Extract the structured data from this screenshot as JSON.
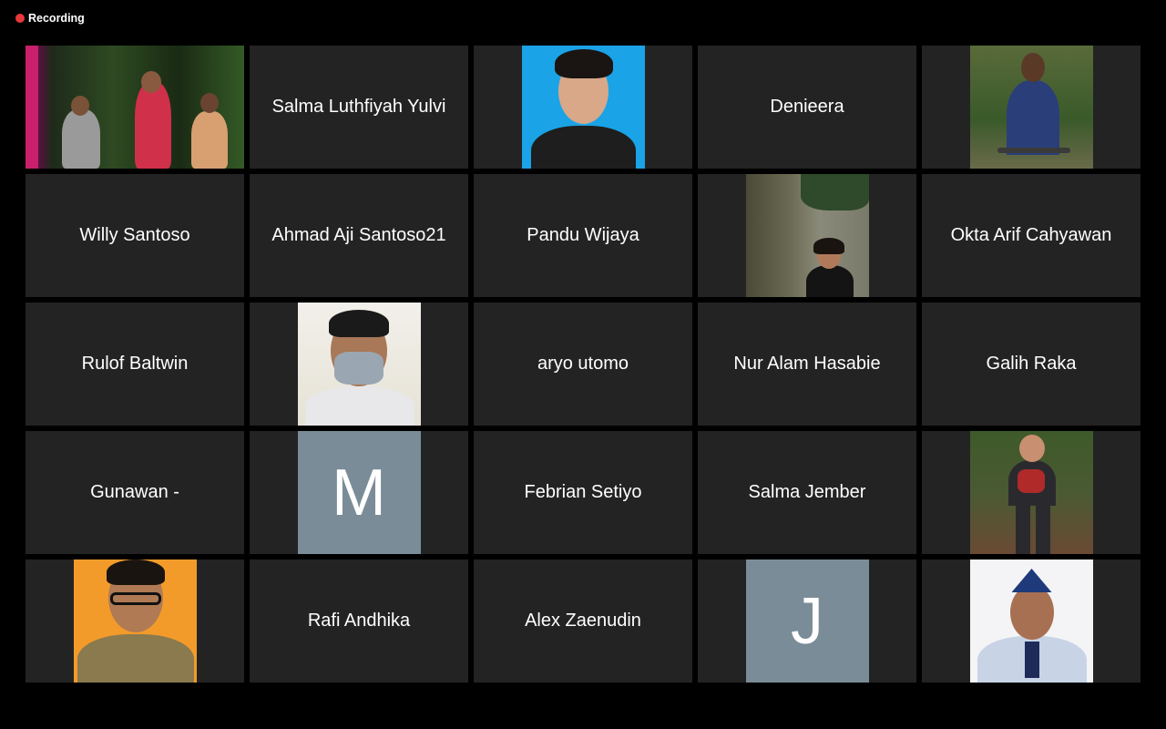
{
  "recording": {
    "label": "Recording",
    "dot_color": "#e8383b"
  },
  "participants": [
    {
      "kind": "video",
      "scene": "concert-stage"
    },
    {
      "kind": "name",
      "name": "Salma Luthfiyah Yulvi"
    },
    {
      "kind": "photo",
      "photo": "man-blue-background"
    },
    {
      "kind": "name",
      "name": "Denieera"
    },
    {
      "kind": "photo",
      "photo": "man-blue-jacket-bicycle-garden"
    },
    {
      "kind": "name",
      "name": "Willy Santoso"
    },
    {
      "kind": "name",
      "name": "Ahmad Aji Santoso21"
    },
    {
      "kind": "name",
      "name": "Pandu Wijaya"
    },
    {
      "kind": "photo",
      "photo": "woman-plants-wall"
    },
    {
      "kind": "name",
      "name": "Okta Arif Cahyawan"
    },
    {
      "kind": "name",
      "name": "Rulof Baltwin"
    },
    {
      "kind": "photo",
      "photo": "man-face-mask-white-shirt"
    },
    {
      "kind": "name",
      "name": "aryo utomo"
    },
    {
      "kind": "name",
      "name": "Nur Alam Hasabie"
    },
    {
      "kind": "name",
      "name": "Galih Raka"
    },
    {
      "kind": "name",
      "name": "Gunawan -"
    },
    {
      "kind": "letter",
      "letter": "M",
      "color": "#7a8c97"
    },
    {
      "kind": "name",
      "name": "Febrian Setiyo"
    },
    {
      "kind": "name",
      "name": "Salma Jember"
    },
    {
      "kind": "photo",
      "photo": "person-red-shirt-forest"
    },
    {
      "kind": "photo",
      "photo": "man-glasses-uniform-orange-background"
    },
    {
      "kind": "name",
      "name": "Rafi Andhika"
    },
    {
      "kind": "name",
      "name": "Alex Zaenudin"
    },
    {
      "kind": "letter",
      "letter": "J",
      "color": "#7a8c97"
    },
    {
      "kind": "photo",
      "photo": "man-cap-uniform-white-background"
    }
  ]
}
